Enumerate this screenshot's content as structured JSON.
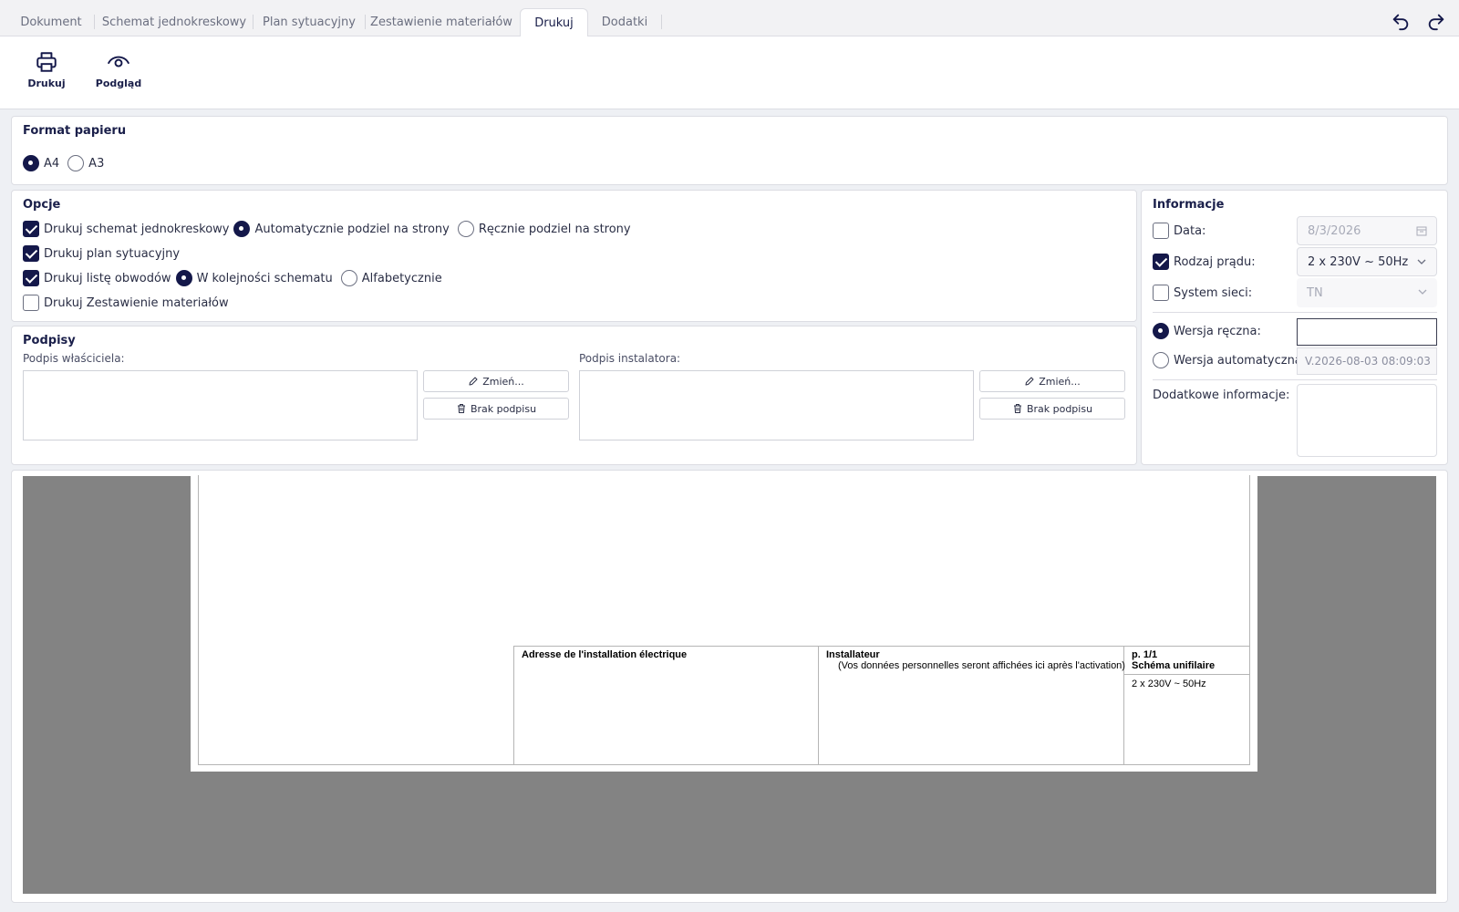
{
  "tabs": [
    {
      "label": "Dokument"
    },
    {
      "label": "Schemat jednokreskowy"
    },
    {
      "label": "Plan sytuacyjny"
    },
    {
      "label": "Zestawienie materiałów"
    },
    {
      "label": "Drukuj"
    },
    {
      "label": "Dodatki"
    }
  ],
  "active_tab": "Drukuj",
  "ribbon": {
    "print_label": "Drukuj",
    "preview_label": "Podgląd"
  },
  "paper_format": {
    "title": "Format papieru",
    "options": [
      {
        "label": "A4",
        "selected": true
      },
      {
        "label": "A3",
        "selected": false
      }
    ]
  },
  "options": {
    "title": "Opcje",
    "print_schematic": {
      "label": "Drukuj schemat jednokreskowy",
      "checked": true
    },
    "auto_split": {
      "label": "Automatycznie podziel na strony",
      "selected": true
    },
    "manual_split": {
      "label": "Ręcznie podziel na strony",
      "selected": false
    },
    "print_plan": {
      "label": "Drukuj plan sytuacyjny",
      "checked": true
    },
    "print_circuits": {
      "label": "Drukuj listę obwodów",
      "checked": true
    },
    "order_schema": {
      "label": "W kolejności schematu",
      "selected": true
    },
    "order_alpha": {
      "label": "Alfabetycznie",
      "selected": false
    },
    "print_materials": {
      "label": "Drukuj Zestawienie materiałów",
      "checked": false
    }
  },
  "signatures": {
    "title": "Podpisy",
    "owner_label": "Podpis właściciela:",
    "installer_label": "Podpis instalatora:",
    "change_label": "Zmień...",
    "no_signature_label": "Brak podpisu"
  },
  "info": {
    "title": "Informacje",
    "date": {
      "label": "Data:",
      "checked": false,
      "value": "8/3/2026"
    },
    "current_type": {
      "label": "Rodzaj prądu:",
      "checked": true,
      "value": "2 x 230V ~ 50Hz"
    },
    "network_system": {
      "label": "System sieci:",
      "checked": false,
      "value": "TN"
    },
    "manual_version": {
      "label": "Wersja ręczna:",
      "selected": true,
      "value": ""
    },
    "auto_version": {
      "label": "Wersja automatyczna:",
      "selected": false,
      "value": "V.2026-08-03 08:09:03"
    },
    "additional_label": "Dodatkowe informacje:",
    "additional_value": ""
  },
  "preview": {
    "address_title": "Adresse de l'installation électrique",
    "installer_title": "Installateur",
    "installer_note": "(Vos données personnelles seront affichées ici après l'activation)",
    "page_number": "p. 1/1",
    "doc_type": "Schéma unifilaire",
    "current_type": "2 x 230V ~ 50Hz"
  },
  "colors": {
    "accent": "#14184a",
    "preview_bg": "#838383"
  }
}
